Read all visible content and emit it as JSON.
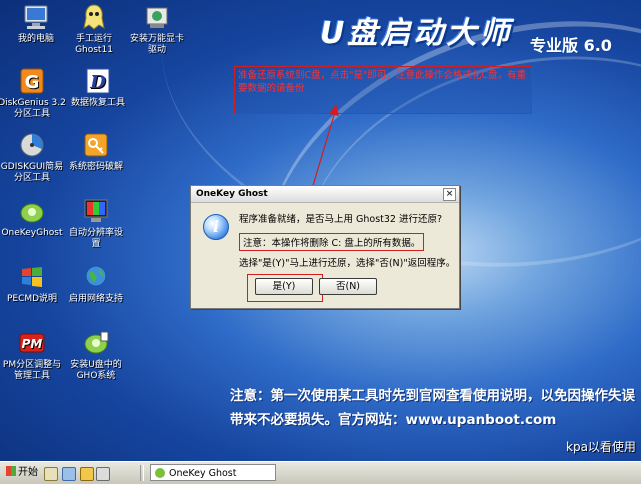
{
  "brand": {
    "title": "U盘启动大师",
    "edition": "专业版 6.0"
  },
  "desktop_icons": [
    {
      "label": "我的电脑"
    },
    {
      "label": "手工运行\nGhost11"
    },
    {
      "label": "安装万能显卡\n驱动"
    },
    {
      "label": "DiskGenius 3.2\n分区工具"
    },
    {
      "label": "数据恢复工具"
    },
    {
      "label": "GDISKGUI简易\n分区工具"
    },
    {
      "label": "系统密码破解"
    },
    {
      "label": "OneKeyGhost"
    },
    {
      "label": "自动分辨率设\n置"
    },
    {
      "label": "PECMD说明"
    },
    {
      "label": "启用网络支持"
    },
    {
      "label": "PM分区调整与\n管理工具"
    },
    {
      "label": "安装U盘中的\nGHO系统"
    }
  ],
  "annotation": {
    "text": "准备还原系统到C盘，点击\"是\"即可。注意此操作会格式化C盘，有重要数据的请备份"
  },
  "dialog": {
    "title": "OneKey Ghost",
    "line1": "程序准备就绪，是否马上用 Ghost32 进行还原?",
    "line2": "注意：本操作将删除 C: 盘上的所有数据。",
    "line3": "选择\"是(Y)\"马上进行还原，选择\"否(N)\"返回程序。",
    "yes_label": "是(Y)",
    "no_label": "否(N)",
    "close_label": "×"
  },
  "notice": {
    "line1": "注意：第一次使用某工具时先到官网查看使用说明，以免因操作失误",
    "line2": "带来不必要损失。官方网站：www.upanboot.com"
  },
  "watermark": "kpa以看使用",
  "taskbar": {
    "start_label": "开始",
    "task_label": "OneKey Ghost"
  }
}
